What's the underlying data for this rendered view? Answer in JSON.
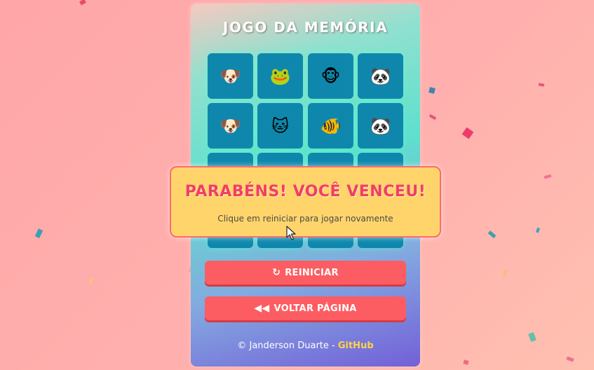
{
  "game": {
    "title": "JOGO DA MEMÓRIA",
    "cards": [
      {
        "icon": "dog-icon",
        "glyph": "🐶"
      },
      {
        "icon": "frog-icon",
        "glyph": "🐸"
      },
      {
        "icon": "monkey-icon",
        "glyph": "🐵"
      },
      {
        "icon": "panda-icon",
        "glyph": "🐼"
      },
      {
        "icon": "dog-icon",
        "glyph": "🐶"
      },
      {
        "icon": "cat-icon",
        "glyph": "🐱"
      },
      {
        "icon": "fish-icon",
        "glyph": "🐠"
      },
      {
        "icon": "panda-icon",
        "glyph": "🐼"
      }
    ]
  },
  "modal": {
    "title": "PARABÉNS! VOCÊ VENCEU!",
    "subtitle": "Clique em reiniciar para jogar novamente"
  },
  "buttons": {
    "restart_label": "REINICIAR",
    "back_label": "VOLTAR PÁGINA"
  },
  "footer": {
    "copyright": "© Janderson Duarte -",
    "link": "GitHub"
  },
  "colors": {
    "background": "#ffa6a8",
    "card": "#0f87ad",
    "button": "#fc5d62",
    "modal_bg": "#ffd56b",
    "modal_title": "#f13e66",
    "link": "#ffd24a"
  }
}
